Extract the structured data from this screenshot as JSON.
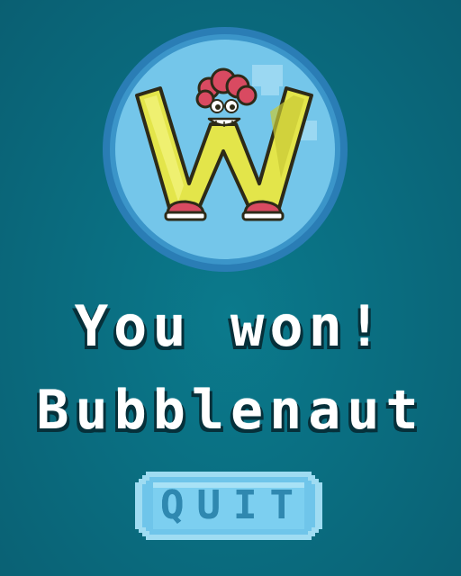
{
  "screen": {
    "headline": "You won!",
    "player_name": "Bubblenaut"
  },
  "emblem": {
    "letter": "W",
    "character": "smiling-letter-w-mascot"
  },
  "actions": {
    "quit_label": "QUIT"
  },
  "colors": {
    "background": "#0a6f82",
    "bubble_fill": "#74c6ea",
    "bubble_ring": "#2b7fb5",
    "letter_fill": "#e3e54a",
    "hair": "#d94a61",
    "shoes": "#d94a61",
    "button_fill": "#7ed0ee",
    "button_text": "#2f88b0",
    "title_text": "#ffffff"
  }
}
